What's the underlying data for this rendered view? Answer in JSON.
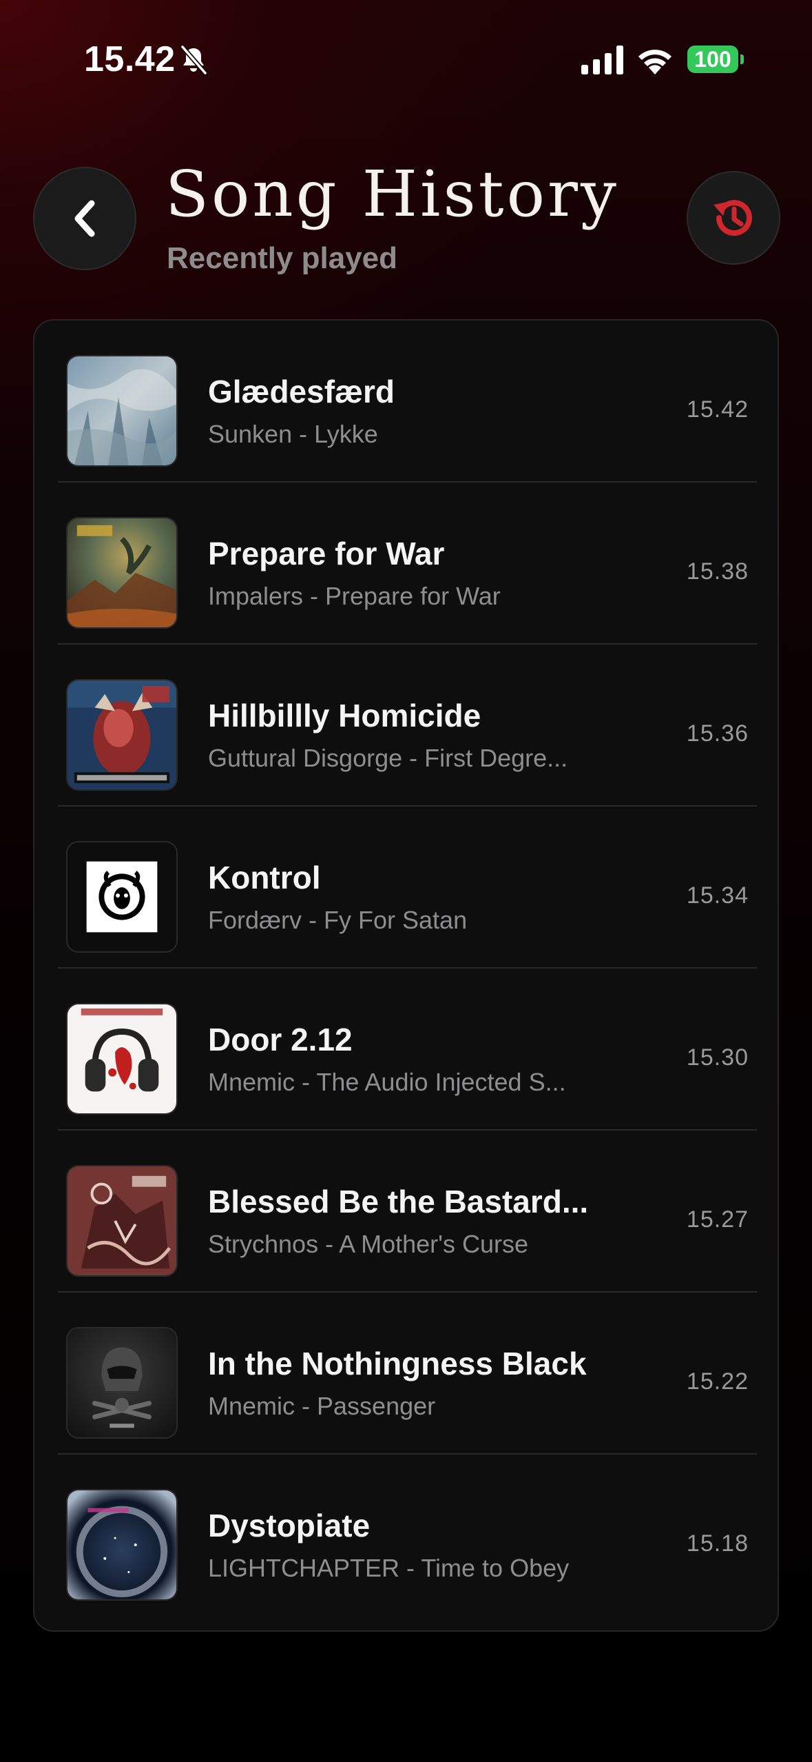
{
  "status_bar": {
    "time": "15.42",
    "battery": "100",
    "icons": [
      "bell-slash-icon",
      "cellular-signal-icon",
      "wifi-icon",
      "battery-icon"
    ],
    "battery_color": "#34c759"
  },
  "header": {
    "title": "Song History",
    "subtitle": "Recently played",
    "back_icon": "chevron-left-icon",
    "history_icon": "history-icon",
    "accent_color": "#d0262c"
  },
  "songs": [
    {
      "title": "Glædesfærd",
      "subtitle": "Sunken - Lykke",
      "time": "15.42"
    },
    {
      "title": "Prepare for War",
      "subtitle": "Impalers - Prepare for War",
      "time": "15.38"
    },
    {
      "title": "Hillbillly Homicide",
      "subtitle": "Guttural Disgorge - First Degre...",
      "time": "15.36"
    },
    {
      "title": "Kontrol",
      "subtitle": "Fordærv - Fy For Satan",
      "time": "15.34"
    },
    {
      "title": "Door 2.12",
      "subtitle": "Mnemic - The Audio Injected S...",
      "time": "15.30"
    },
    {
      "title": "Blessed Be the Bastard...",
      "subtitle": "Strychnos - A Mother's Curse",
      "time": "15.27"
    },
    {
      "title": "In the Nothingness Black",
      "subtitle": "Mnemic - Passenger",
      "time": "15.22"
    },
    {
      "title": "Dystopiate",
      "subtitle": "LIGHTCHAPTER - Time to Obey",
      "time": "15.18"
    }
  ]
}
